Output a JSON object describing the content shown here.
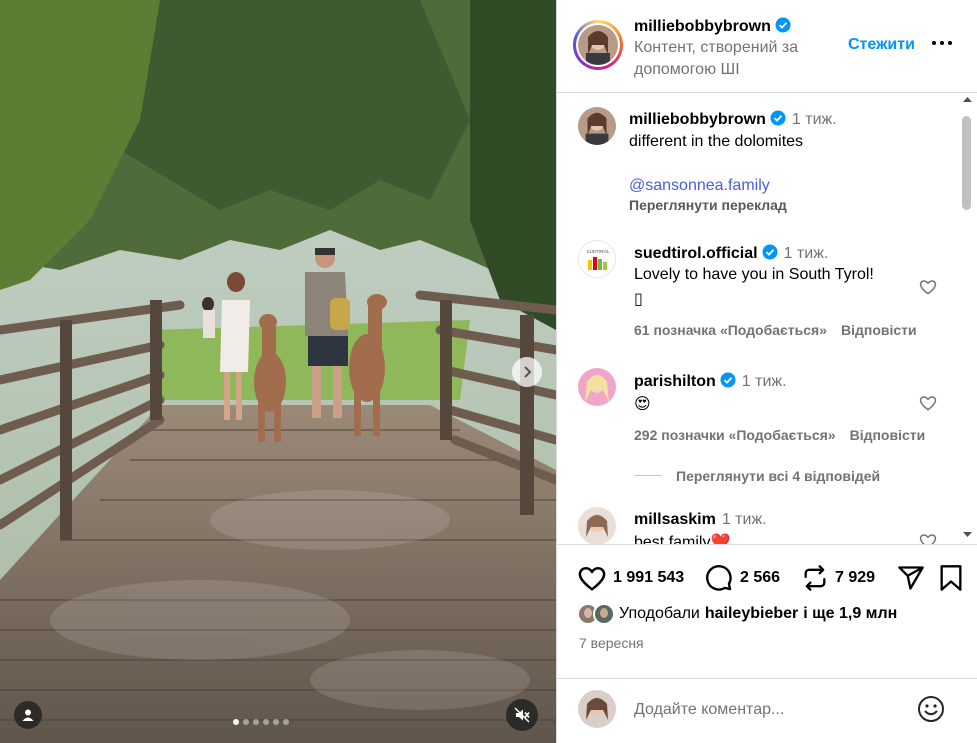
{
  "post": {
    "media": {
      "slide_count": 6,
      "active_slide": 1
    },
    "author": {
      "username": "milliebobbybrown",
      "subtitle": "Контент, створений за допомогою ШІ",
      "follow_label": "Стежити"
    },
    "caption": {
      "username": "milliebobbybrown",
      "time": "1 тиж.",
      "text": "different in the dolomites",
      "mention": "@sansonnea.family",
      "translate_label": "Переглянути переклад"
    },
    "comments": [
      {
        "username": "suedtirol.official",
        "time": "1 тиж.",
        "text": "Lovely to have you in South Tyrol!",
        "text2": "▯",
        "likes": "61 позначка «Подобається»",
        "reply": "Відповісти",
        "avatar_text": "SÜDTIROL"
      },
      {
        "username": "parishilton",
        "time": "1 тиж.",
        "text": "😍",
        "likes": "292 позначки «Подобається»",
        "reply": "Відповісти",
        "view_replies": "Переглянути всі 4 відповідей"
      },
      {
        "username": "millsaskim",
        "time": "1 тиж.",
        "text": "best family❤️"
      }
    ],
    "stats": {
      "likes": "1 991 543",
      "comments": "2 566",
      "reposts": "7 929"
    },
    "liked_by": {
      "prefix": "Уподобали",
      "user": "haileybieber",
      "suffix": "і ще 1,9 млн"
    },
    "date": "7 вересня",
    "add_comment_placeholder": "Додайте коментар..."
  },
  "colors": {
    "accent": "#0095f6",
    "muted": "#737373",
    "verified": "#0095f6",
    "divider": "#dbdbdb"
  },
  "icons": [
    "chevron-right-icon",
    "user-tag-icon",
    "mute-icon",
    "verified-icon",
    "more-icon",
    "heart-icon",
    "comment-icon",
    "repost-icon",
    "share-icon",
    "bookmark-icon",
    "emoji-icon"
  ]
}
